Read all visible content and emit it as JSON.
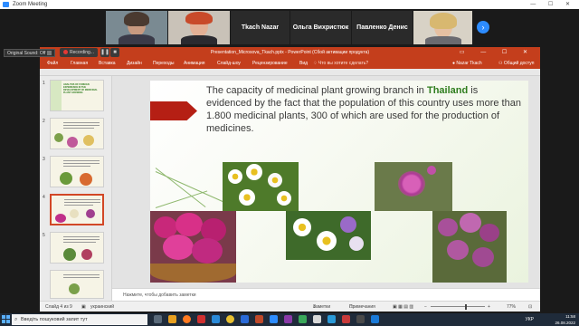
{
  "zoom": {
    "window_title": "Zoom Meeting",
    "participants": [
      {
        "name": ""
      },
      {
        "name": ""
      },
      {
        "name": "Tkach Nazar"
      },
      {
        "name": "Ольга Вихристюк"
      },
      {
        "name": "Павленко Денис"
      },
      {
        "name": ""
      }
    ],
    "original_sound": "Original Sound: Off",
    "recording": "Recording..."
  },
  "ppt": {
    "title": "Presentation_Microsova_Tkach.pptx - PowerPoint (Сбой активации продукта)",
    "tabs": [
      "Файл",
      "Главная",
      "Вставка",
      "Дизайн",
      "Переходы",
      "Анимация",
      "Слайд-шоу",
      "Рецензирование",
      "Вид"
    ],
    "search_placeholder": "Что вы хотите сделать?",
    "user": "Nazar Tkach",
    "share": "Общий доступ",
    "thumbnails": [
      {
        "num": "1",
        "caption": "ANALYSIS OF FOREIGN EXPERIENCE IN THE DEVELOPMENT OF MEDICINAL PLANT GROWING"
      },
      {
        "num": "2",
        "caption": ""
      },
      {
        "num": "3",
        "caption": ""
      },
      {
        "num": "4",
        "caption": ""
      },
      {
        "num": "5",
        "caption": ""
      }
    ],
    "slide": {
      "text_before": "The capacity of medicinal plant growing branch in ",
      "highlight": "Thailand",
      "text_after": " is evidenced by the fact that the population of this country uses more than 1.800 medicinal plants, 300 of which are used for the production of medicines."
    },
    "notes_placeholder": "Нажмите, чтобы добавить заметки",
    "status": {
      "slide_of": "Слайд 4 из 9",
      "language": "украинский",
      "notes_btn": "Заметки",
      "comments_btn": "Примечания",
      "zoom": "77%"
    }
  },
  "taskbar": {
    "search": "Введіть пошуковий запит тут",
    "lang": "УКР",
    "time": "11:58",
    "date": "26.08.2022"
  },
  "colors": {
    "ppt_accent": "#c43e1c",
    "highlight_green": "#2f7d1e",
    "zoom_blue": "#2d8cff"
  }
}
